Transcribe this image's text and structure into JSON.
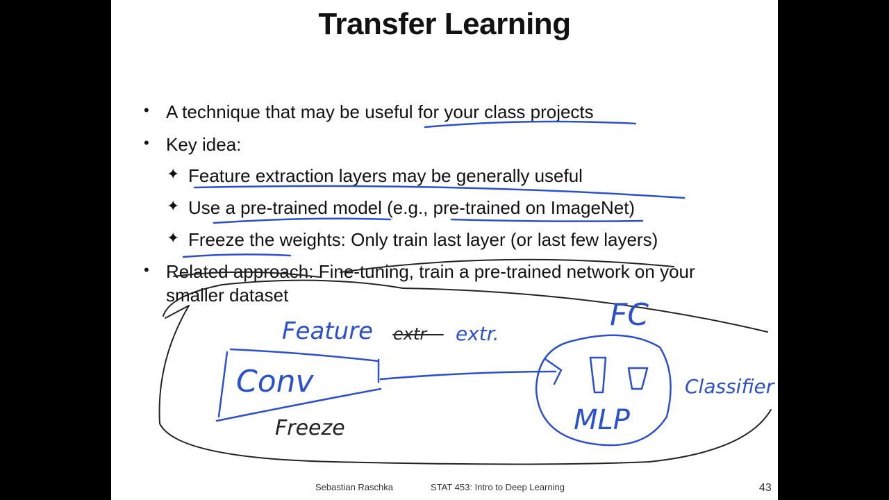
{
  "slide": {
    "title": "Transfer Learning",
    "bullets": [
      {
        "marker": "•",
        "text": "A technique that may be useful for your class projects"
      },
      {
        "marker": "•",
        "text": "Key idea:"
      }
    ],
    "sub_bullets": [
      {
        "marker": "✦",
        "text": "Feature extraction layers may be generally useful"
      },
      {
        "marker": "✦",
        "text": "Use a pre-trained model (e.g., pre-trained on ImageNet)"
      },
      {
        "marker": "✦",
        "text": "Freeze the weights: Only train last layer (or last few layers)"
      }
    ],
    "last_bullet": {
      "marker": "•",
      "line1": "Related approach: Fine-tuning, train a pre-trained network on your",
      "line2": "smaller dataset"
    },
    "annotations": {
      "feature_extr": "Feature",
      "feature_struck": "extr",
      "feature_extr_tail": "extr.",
      "conv": "Conv",
      "freeze": "Freeze",
      "fc": "FC",
      "mlp": "MLP",
      "classifier": "Classifier"
    },
    "footer": {
      "author": "Sebastian Raschka",
      "course": "STAT 453: Intro to Deep Learning",
      "page": "43"
    },
    "colors": {
      "ink_blue": "#2a4fcf",
      "ink_black": "#222222",
      "background": "#000000",
      "slide": "#ffffff"
    }
  }
}
